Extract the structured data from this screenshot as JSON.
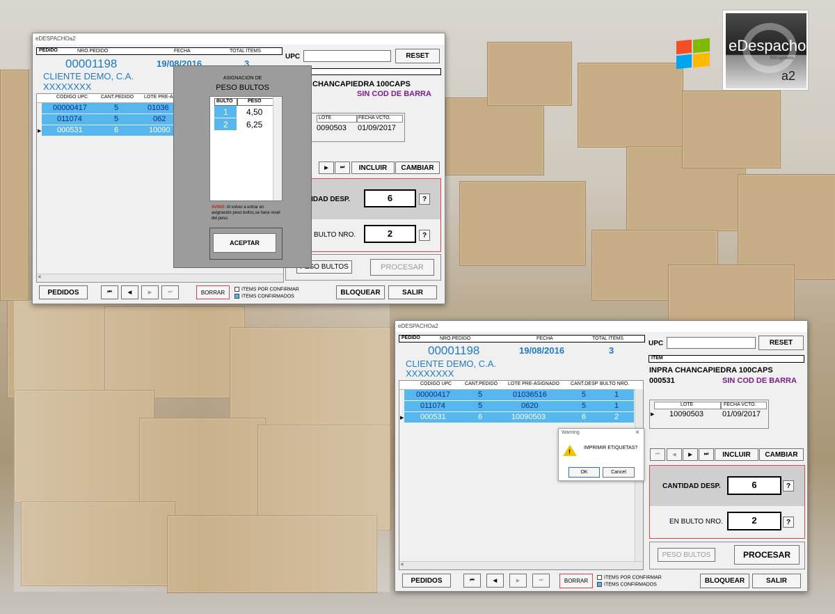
{
  "logo": {
    "name": "eDespacho",
    "sub": "RSI.systems",
    "suffix": "a2"
  },
  "windows_logo": {
    "name": "windows-logo-icon",
    "colors": [
      "#f25022",
      "#7fba00",
      "#00a4ef",
      "#ffb900"
    ]
  },
  "w1": {
    "title": "eDESPACHOa2",
    "hdr": {
      "pedido_tab": "PEDIDO",
      "nro_label": "NRO.PEDIDO",
      "fecha_label": "FECHA",
      "total_label": "TOTAL ITEMS"
    },
    "nro": "00001198",
    "fecha": "19/08/2016",
    "total": "3",
    "cliente": "CLIENTE DEMO, C.A.",
    "rif": "XXXXXXXX",
    "upc_label": "UPC",
    "reset": "RESET",
    "item_name": "CHANCAPIEDRA 100CAPS",
    "item_barcode": "SIN COD DE BARRA",
    "grid": {
      "cols": [
        "CODIGO UPC",
        "CANT.PEDIDO",
        "LOTE PRE-ASIG"
      ],
      "rows": [
        [
          "00000417",
          "5",
          "01036"
        ],
        [
          "011074",
          "5",
          "062"
        ],
        [
          "000531",
          "6",
          "10090"
        ]
      ]
    },
    "lote_cols": [
      "LOTE",
      "FECHA VCTO."
    ],
    "lote_row": [
      "0090503",
      "01/09/2017"
    ],
    "incluir": "INCLUIR",
    "cambiar": "CAMBIAR",
    "cant_label": "TIDAD DESP.",
    "cant_value": "6",
    "bulto_label": "N BULTO NRO.",
    "bulto_value": "2",
    "q": "?",
    "peso_btn": "PESO BULTOS",
    "procesar_btn": "PROCESAR",
    "pedidos": "PEDIDOS",
    "borrar": "BORRAR",
    "legend1": "ITEMS POR CONFIRMAR",
    "legend2": "ITEMS CONFIRMADOS",
    "bloquear": "BLOQUEAR",
    "salir": "SALIR",
    "nav": {
      "first": "⏮",
      "prev": "◀",
      "next": "▶",
      "last": "⏭"
    },
    "dialog": {
      "title_small": "ASIGNACION DE",
      "title_big": "PESO BULTOS",
      "cols": [
        "BULTO",
        "PESO"
      ],
      "rows": [
        [
          "1",
          "4,50"
        ],
        [
          "2",
          "6,25"
        ]
      ],
      "aviso_label": "AVISO:",
      "aviso_text": "Al volver a entrar en asignación peso bultos,se hace reset del peso.",
      "aceptar": "ACEPTAR"
    }
  },
  "w2": {
    "title": "eDESPACHOa2",
    "hdr": {
      "pedido_tab": "PEDIDO",
      "nro_label": "NRO.PEDIDO",
      "fecha_label": "FECHA",
      "total_label": "TOTAL ITEMS"
    },
    "nro": "00001198",
    "fecha": "19/08/2016",
    "total": "3",
    "cliente": "CLIENTE DEMO, C.A.",
    "rif": "XXXXXXXX",
    "upc_label": "UPC",
    "reset": "RESET",
    "item_tab": "ITEM",
    "item_name": "INPRA CHANCAPIEDRA 100CAPS",
    "item_code": "000531",
    "item_barcode": "SIN COD DE BARRA",
    "grid": {
      "cols": [
        "CODIGO UPC",
        "CANT.PEDIDO",
        "LOTE PRE-ASIGNADO",
        "CANT.DESP",
        "BULTO NRO."
      ],
      "rows": [
        [
          "00000417",
          "5",
          "01036516",
          "5",
          "1"
        ],
        [
          "011074",
          "5",
          "0620",
          "5",
          "1"
        ],
        [
          "000531",
          "6",
          "10090503",
          "6",
          "2"
        ]
      ]
    },
    "lote_cols": [
      "LOTE",
      "FECHA VCTO."
    ],
    "lote_row": [
      "10090503",
      "01/09/2017"
    ],
    "incluir": "INCLUIR",
    "cambiar": "CAMBIAR",
    "cant_label": "CANTIDAD DESP.",
    "cant_value": "6",
    "bulto_label": "EN BULTO NRO.",
    "bulto_value": "2",
    "q": "?",
    "peso_btn": "PESO BULTOS",
    "procesar_btn": "PROCESAR",
    "pedidos": "PEDIDOS",
    "borrar": "BORRAR",
    "legend1": "ITEMS POR CONFIRMAR",
    "legend2": "ITEMS CONFIRMADOS",
    "bloquear": "BLOQUEAR",
    "salir": "SALIR",
    "nav": {
      "first": "⏮",
      "prev": "◀",
      "next": "▶",
      "last": "⏭"
    },
    "warning": {
      "title": "Warning",
      "message": "IMPRIMIR ETIQUETAS?",
      "ok": "OK",
      "cancel": "Cancel"
    }
  }
}
